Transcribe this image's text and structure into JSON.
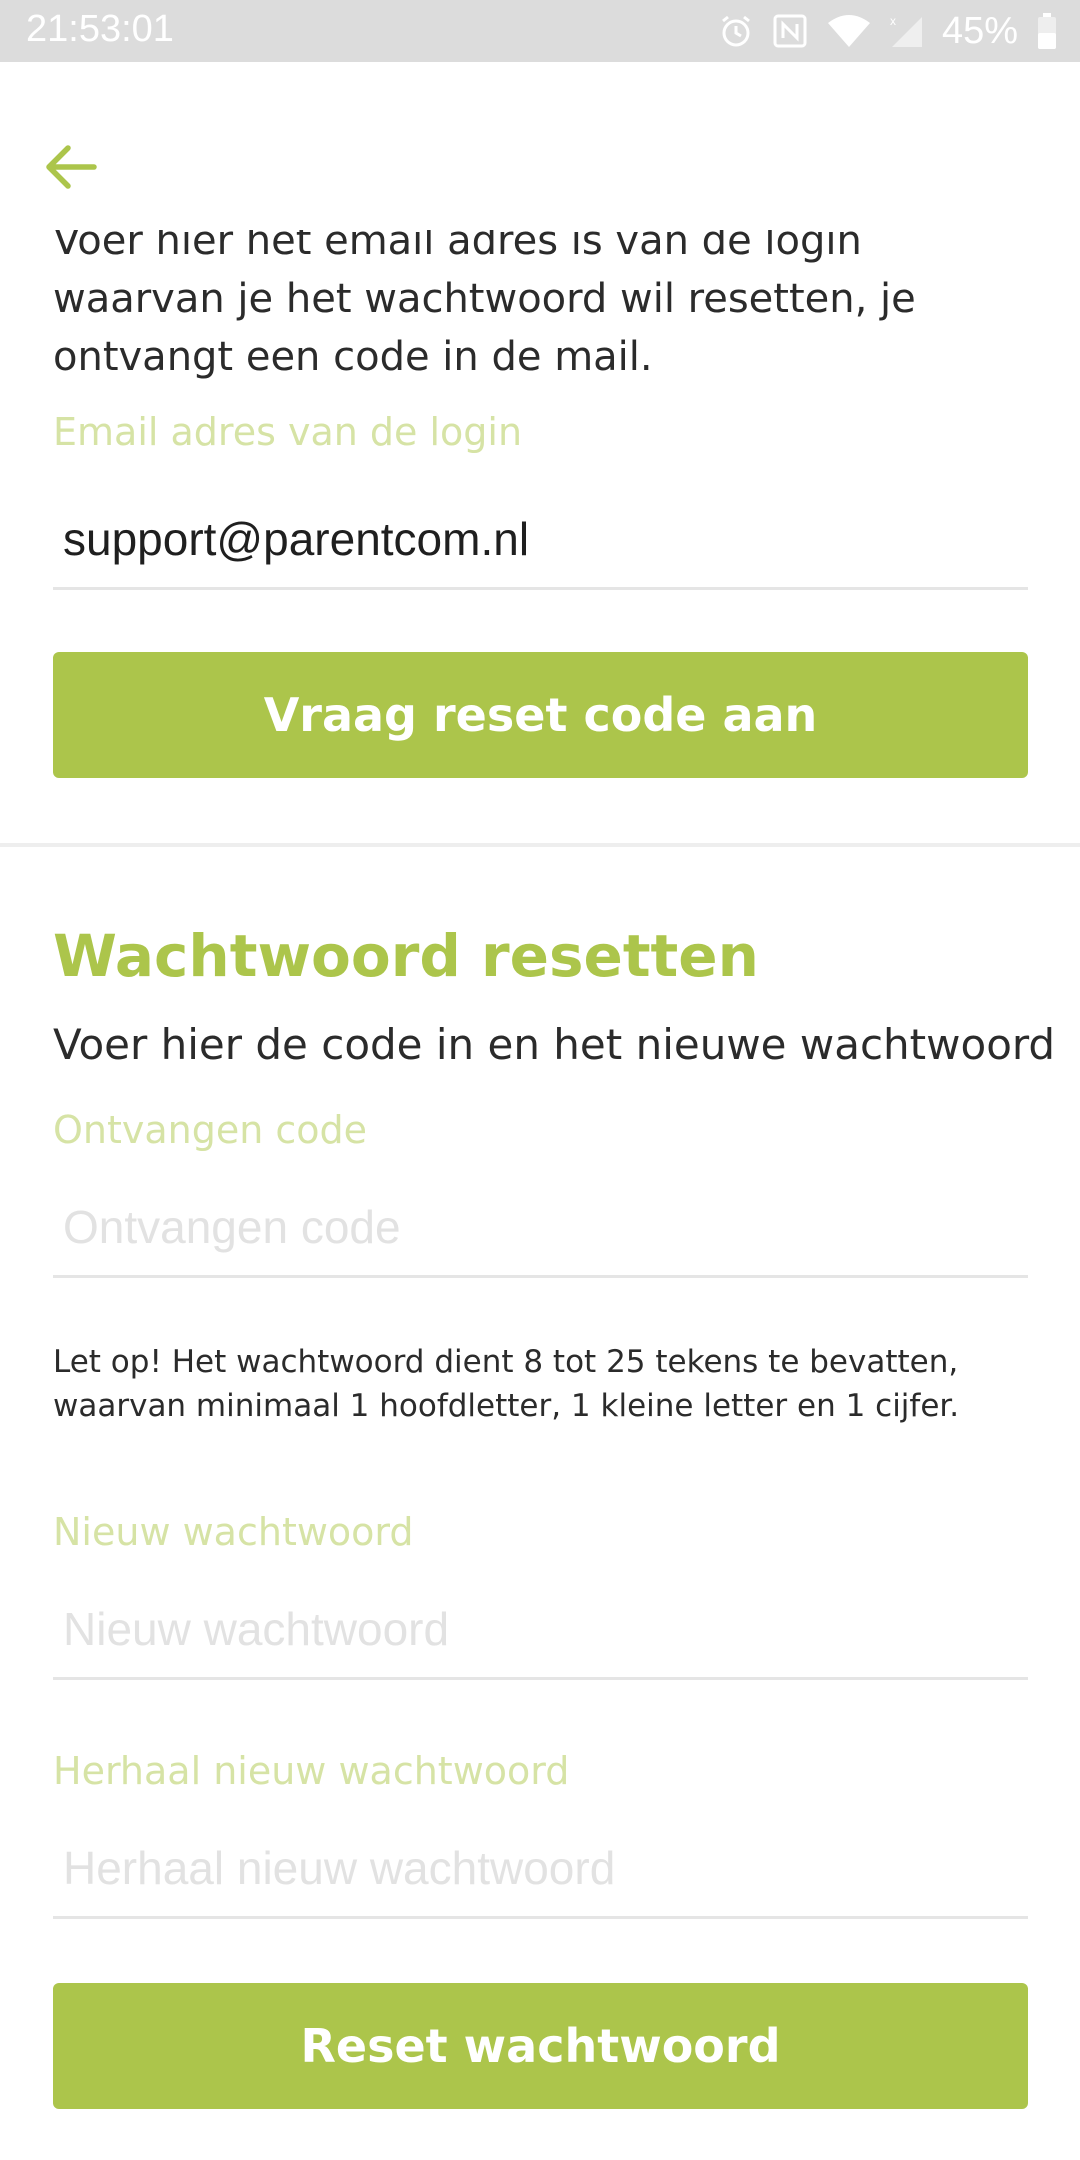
{
  "status_bar": {
    "time": "21:53:01",
    "battery": "45%",
    "icons": [
      "alarm-icon",
      "nfc-icon",
      "wifi-icon",
      "signal-icon",
      "battery-icon"
    ]
  },
  "app_bar": {
    "back_icon": "arrow-left-icon",
    "accent": "#acc54b"
  },
  "request_section": {
    "intro_text": "Voer hier het email adres is van de login waarvan je het wachtwoord wil resetten, je ontvangt een code in de mail.",
    "email_label": "Email adres van de login",
    "email_value": "support@parentcom.nl",
    "request_button": "Vraag reset code aan"
  },
  "reset_section": {
    "title": "Wachtwoord resetten",
    "description": "Voer hier de code in en het nieuwe wachtwoord",
    "code_label": "Ontvangen code",
    "code_placeholder": "Ontvangen code",
    "note": "Let op! Het wachtwoord dient 8 tot 25 tekens te bevatten, waarvan minimaal 1 hoofdletter, 1 kleine letter en 1 cijfer.",
    "new_password_label": "Nieuw wachtwoord",
    "new_password_placeholder": "Nieuw wachtwoord",
    "repeat_password_label": "Herhaal nieuw wachtwoord",
    "repeat_password_placeholder": "Herhaal nieuw wachtwoord",
    "reset_button": "Reset wachtwoord"
  }
}
